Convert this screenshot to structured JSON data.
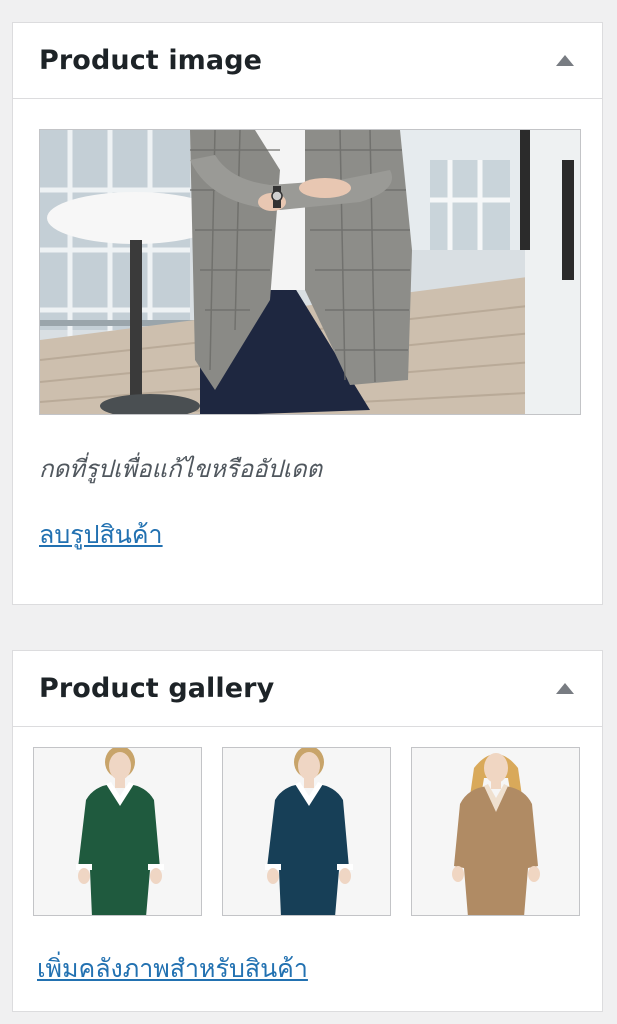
{
  "product_image": {
    "title": "Product image",
    "hint": "กดที่รูปเพื่อแก้ไขหรืออัปเดต",
    "remove_link": "ลบรูปสินค้า"
  },
  "product_gallery": {
    "title": "Product gallery",
    "add_link": "เพิ่มคลังภาพสำหรับสินค้า",
    "thumbnails": [
      {
        "sweater_color": "#1f5a3e"
      },
      {
        "sweater_color": "#173f57"
      },
      {
        "sweater_color": "#b08b64"
      }
    ]
  },
  "colors": {
    "link": "#2271b1",
    "border": "#dcdcde",
    "background": "#f0f0f1"
  },
  "icons": {
    "collapse_toggle": "triangle-up-icon"
  }
}
